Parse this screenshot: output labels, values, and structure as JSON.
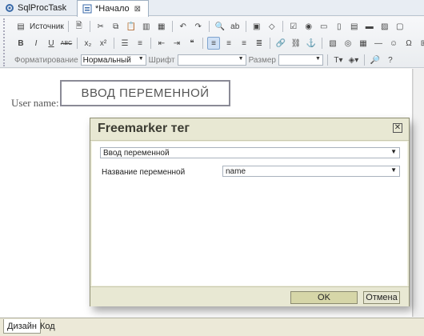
{
  "tabs": [
    {
      "label": "SqlProcTask"
    },
    {
      "label": "*Начало"
    }
  ],
  "toolbar": {
    "source_label": "Источник",
    "format_label": "Форматирование",
    "format_value": "Нормальный",
    "font_label": "Шрифт",
    "font_value": "",
    "size_label": "Размер",
    "size_value": "",
    "bold": "B",
    "italic": "I",
    "underline": "U",
    "strike": "ABC",
    "subscript": "x₂",
    "superscript": "x²"
  },
  "editor": {
    "username_label": "User name:",
    "placeholder_text": "ВВОД ПЕРЕМЕННОЙ"
  },
  "dialog": {
    "title": "Freemarker тег",
    "close": "✕",
    "type_select_value": "Ввод переменной",
    "var_name_label": "Название переменной",
    "var_name_value": "name",
    "ok_label": "OK",
    "cancel_label": "Отмена"
  },
  "bottom_tabs": [
    {
      "label": "Дизайн"
    },
    {
      "label": "Код"
    }
  ],
  "colors": {
    "accent": "#7fa4cf",
    "dialog_bg": "#f0f0e0",
    "ok_button": "#d6d6a8"
  }
}
